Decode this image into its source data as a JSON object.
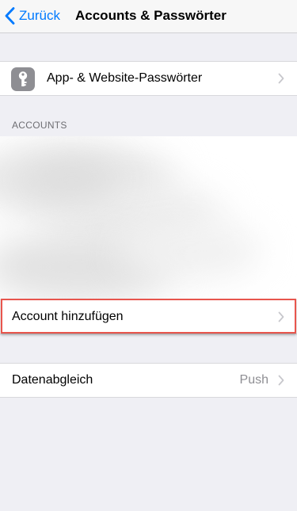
{
  "nav": {
    "back_label": "Zurück",
    "title": "Accounts & Passwörter"
  },
  "passwords_row": {
    "label": "App- & Website-Passwörter",
    "icon": "key-icon"
  },
  "accounts_section": {
    "header": "ACCOUNTS"
  },
  "add_account_row": {
    "label": "Account hinzufügen"
  },
  "fetch_row": {
    "label": "Datenabgleich",
    "value": "Push"
  },
  "colors": {
    "accent": "#007AFF",
    "background": "#EFEFF4",
    "highlight": "#E8554D",
    "secondary_text": "#8E8E93"
  }
}
